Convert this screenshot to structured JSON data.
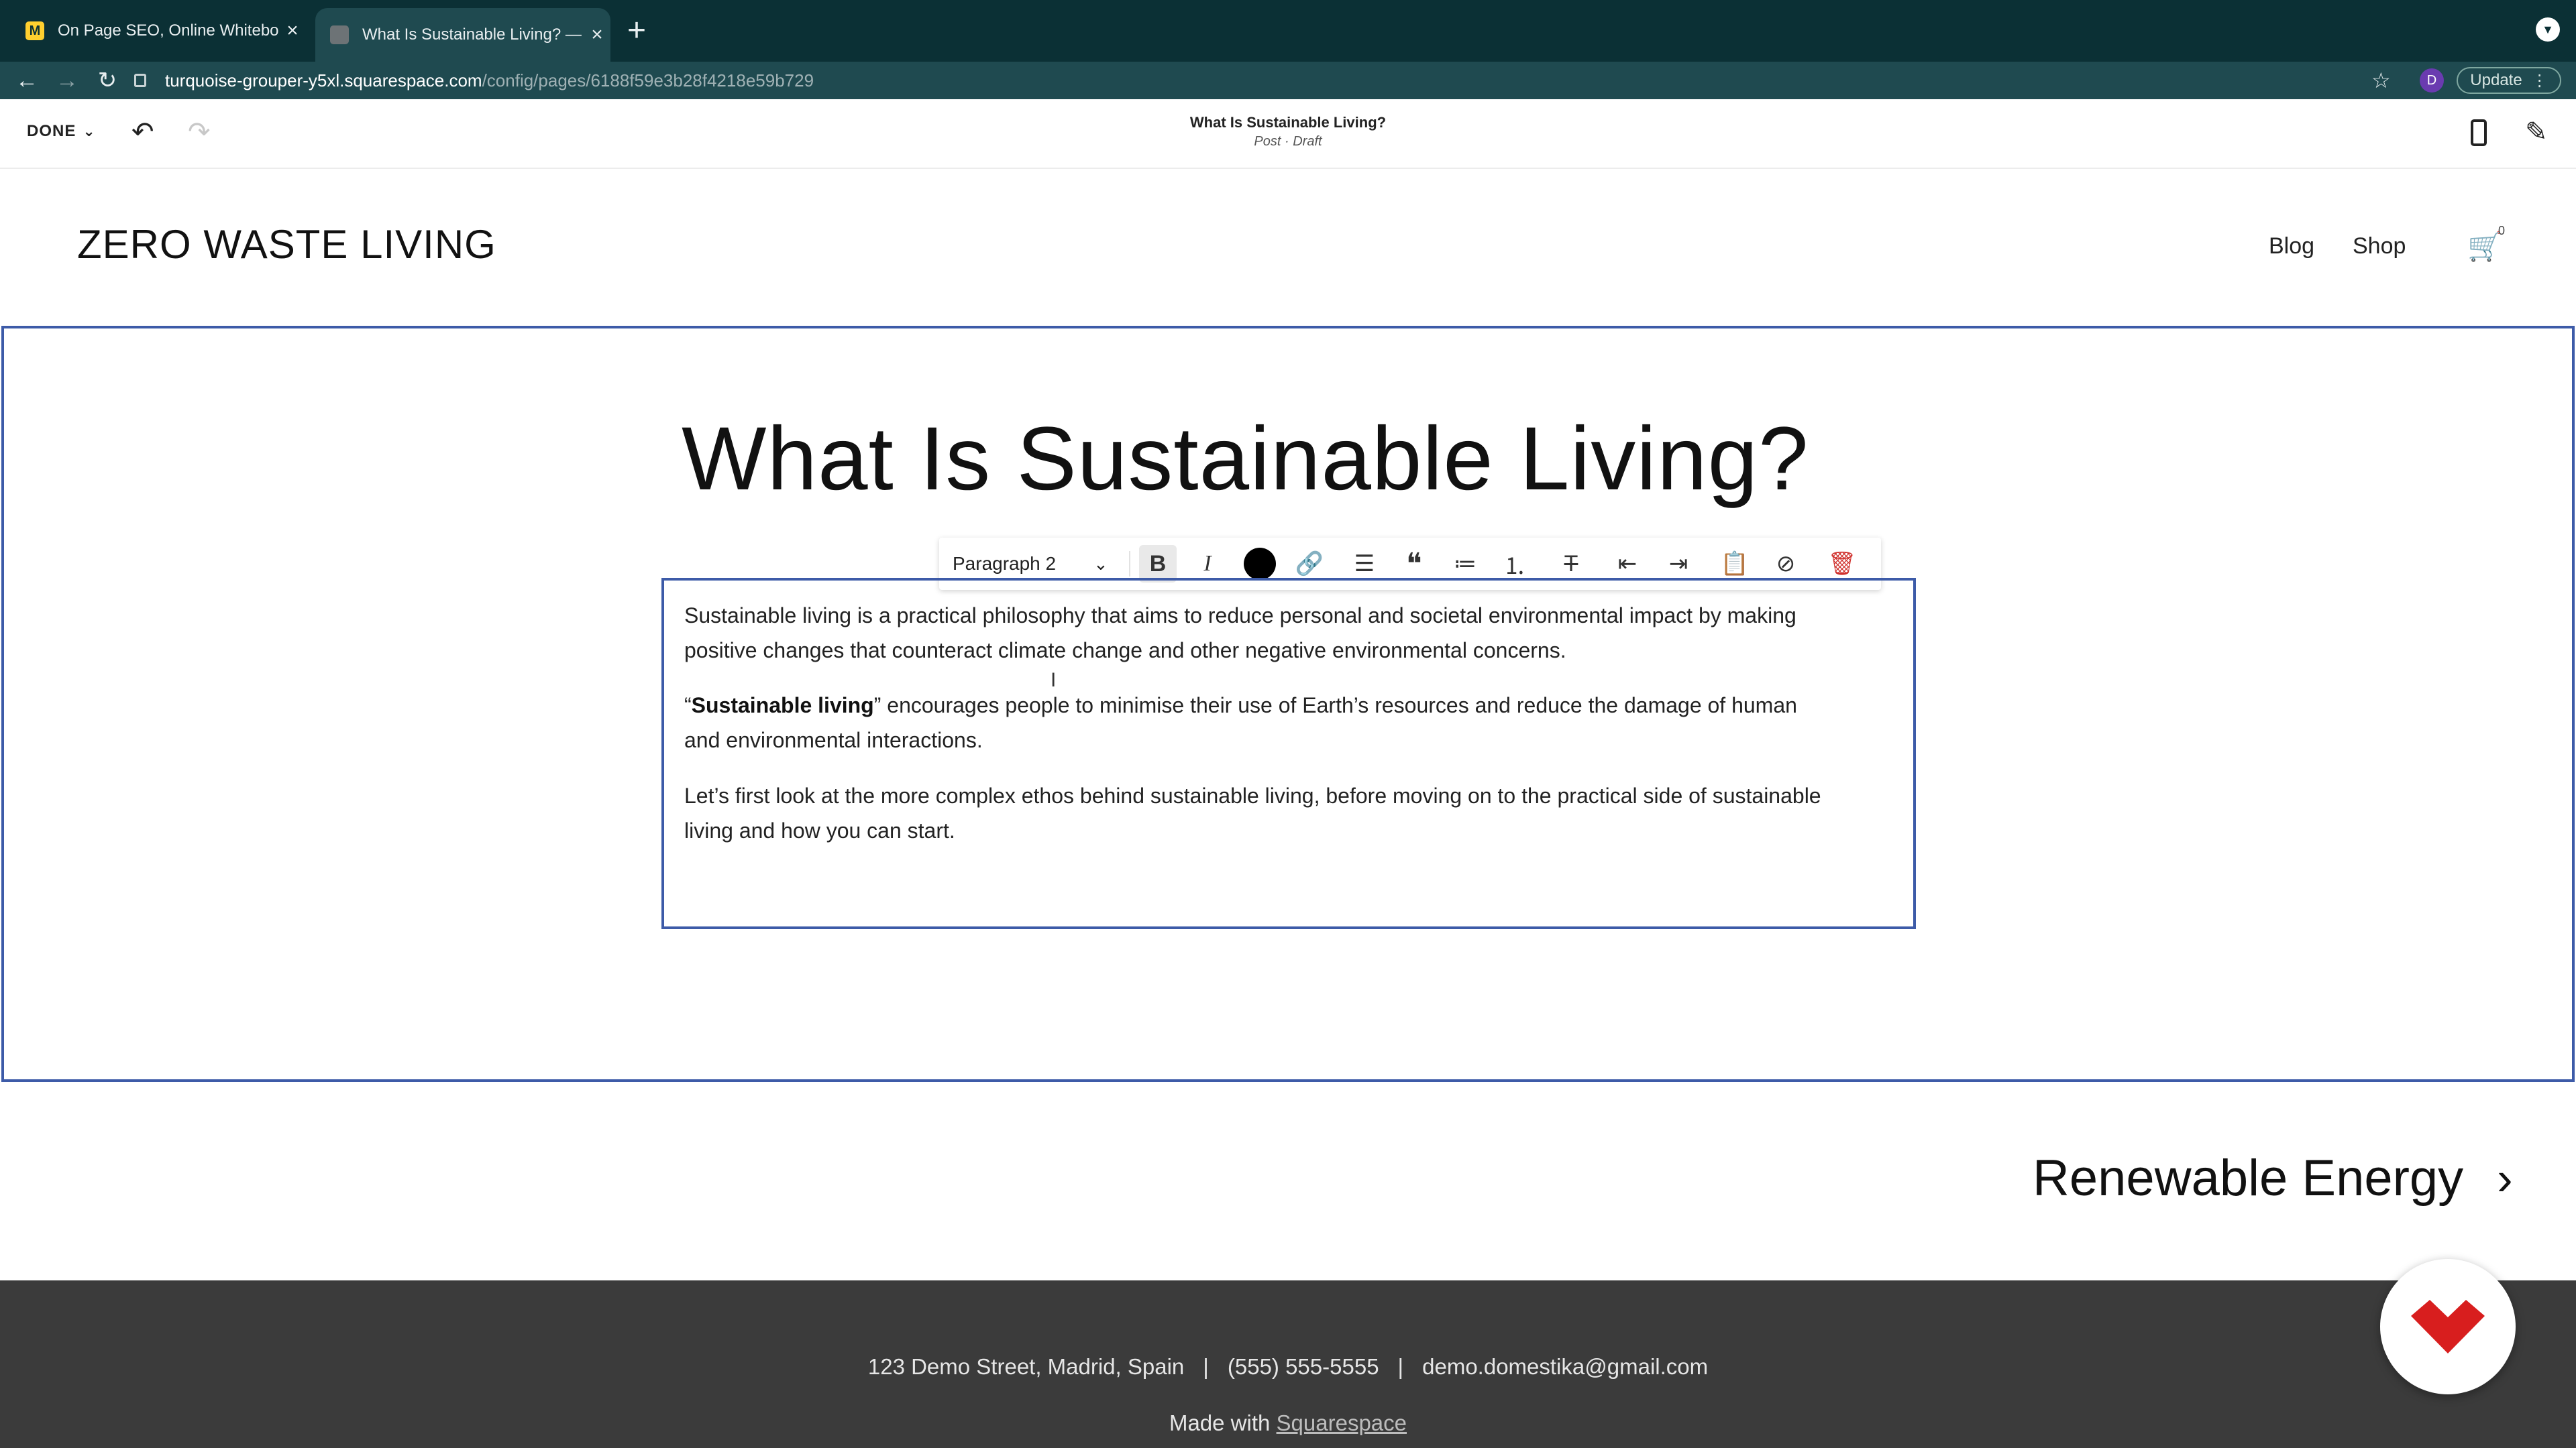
{
  "browser": {
    "tabs": [
      {
        "title": "On Page SEO, Online Whiteboa",
        "active": false
      },
      {
        "title": "What Is Sustainable Living? —",
        "active": true
      }
    ],
    "new_tab": "+",
    "url_host": "turquoise-grouper-y5xl.squarespace.com",
    "url_path": "/config/pages/6188f59e3b28f4218e59b729",
    "profile_initial": "D",
    "update_label": "Update"
  },
  "editor": {
    "done_label": "DONE",
    "page_title": "What Is Sustainable Living?",
    "page_status": "Post · Draft"
  },
  "site": {
    "logo": "ZERO WASTE LIVING",
    "nav": [
      {
        "label": "Blog"
      },
      {
        "label": "Shop"
      }
    ],
    "cart_count": "0"
  },
  "post": {
    "title": "What Is Sustainable Living?",
    "paragraphs": [
      {
        "text_line1": "Sustainable living is a practical philosophy that aims to reduce personal and societal environmental impact by making",
        "text_line2": "positive changes that counteract climate change and other negative environmental concerns."
      },
      {
        "quote_open": "“",
        "bold": "Sustainable living",
        "rest_line1": "” encourages people to minimise their use of Earth’s resources and reduce the damage of human",
        "text_line2": "and environmental interactions."
      },
      {
        "text_line1": "Let’s first look at the more complex ethos behind sustainable living, before moving on to the practical side of sustainable",
        "text_line2": "living and how you can start."
      }
    ]
  },
  "toolbar": {
    "style_label": "Paragraph 2",
    "text_color": "#000000"
  },
  "next_post": {
    "label": "Renewable Energy"
  },
  "footer": {
    "address": "123 Demo Street, Madrid, Spain",
    "phone": "(555) 555-5555",
    "email": "demo.domestika@gmail.com",
    "made_with": "Made with",
    "platform": "Squarespace"
  },
  "colors": {
    "browser_tabbar": "#0b3035",
    "selection_frame": "#3d5ba8",
    "footer_bg": "#3b3b3b",
    "badge_red": "#d81e1e"
  }
}
